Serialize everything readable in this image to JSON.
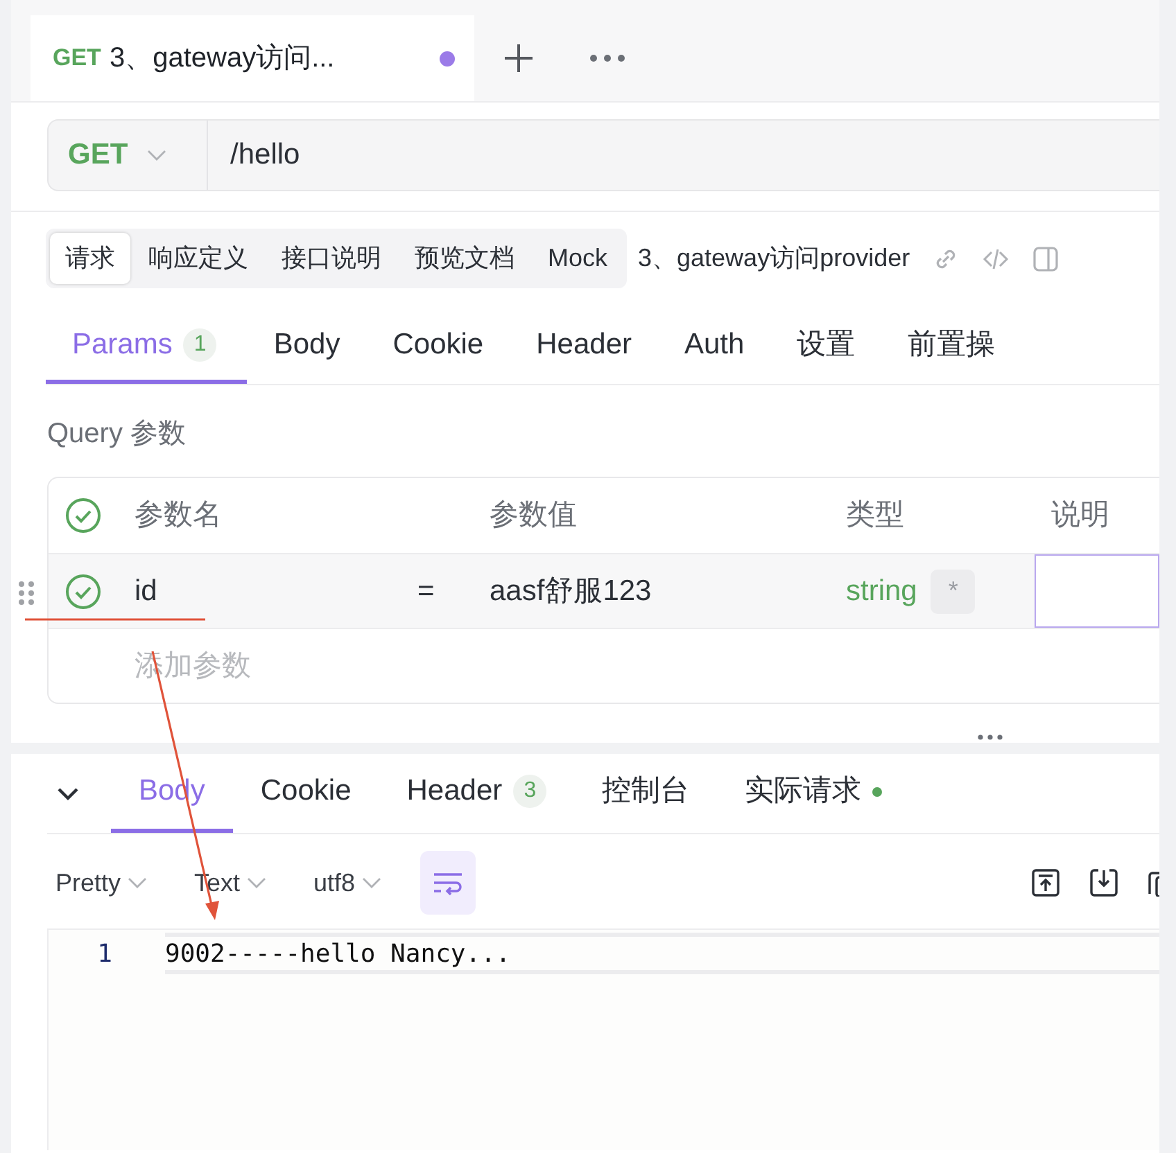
{
  "request_tab": {
    "method": "GET",
    "title": "3、gateway访问...",
    "unsaved": true
  },
  "url": {
    "method": "GET",
    "path": "/hello"
  },
  "doc_tabs": [
    {
      "label": "请求",
      "selected": true
    },
    {
      "label": "响应定义",
      "selected": false
    },
    {
      "label": "接口说明",
      "selected": false
    },
    {
      "label": "预览文档",
      "selected": false
    },
    {
      "label": "Mock",
      "selected": false
    }
  ],
  "api_name": "3、gateway访问provider",
  "param_tabs": [
    {
      "label": "Params",
      "badge": "1",
      "selected": true
    },
    {
      "label": "Body",
      "selected": false
    },
    {
      "label": "Cookie",
      "selected": false
    },
    {
      "label": "Header",
      "selected": false
    },
    {
      "label": "Auth",
      "selected": false
    },
    {
      "label": "设置",
      "selected": false
    },
    {
      "label": "前置操",
      "selected": false
    }
  ],
  "query_title": "Query 参数",
  "params_table": {
    "columns": [
      "参数名",
      "参数值",
      "类型",
      "说明"
    ],
    "all_checked": true,
    "rows": [
      {
        "checked": true,
        "name": "id",
        "equals": "=",
        "value": "aasf舒服123",
        "type": "string",
        "required_mark": "*",
        "description_focused": true
      }
    ],
    "add_placeholder": "添加参数"
  },
  "response_tabs": [
    {
      "label": "Body",
      "selected": true
    },
    {
      "label": "Cookie",
      "selected": false
    },
    {
      "label": "Header",
      "badge": "3",
      "selected": false
    },
    {
      "label": "控制台",
      "selected": false
    },
    {
      "label": "实际请求",
      "dot": true,
      "selected": false
    }
  ],
  "format_selects": [
    "Pretty",
    "Text",
    "utf8"
  ],
  "wrap_on": true,
  "code_lines": [
    {
      "number": "1",
      "text": "9002-----hello Nancy...",
      "highlighted": true
    }
  ],
  "annotation": {
    "kind": "arrow"
  }
}
